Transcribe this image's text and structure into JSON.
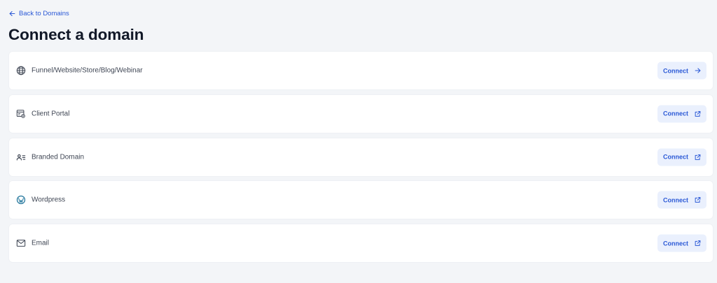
{
  "back_link": {
    "label": "Back to Domains",
    "icon": "arrow-left-icon"
  },
  "page_title": "Connect a domain",
  "colors": {
    "background": "#f3f5f8",
    "card": "#ffffff",
    "accent": "#2b59d6",
    "button_bg": "#eaf0fd",
    "title": "#111827",
    "label": "#3f4654"
  },
  "options": [
    {
      "label": "Funnel/Website/Store/Blog/Webinar",
      "icon": "globe-icon",
      "button_label": "Connect",
      "button_icon": "arrow-right-icon"
    },
    {
      "label": "Client Portal",
      "icon": "client-portal-icon",
      "button_label": "Connect",
      "button_icon": "external-link-icon"
    },
    {
      "label": "Branded Domain",
      "icon": "user-list-icon",
      "button_label": "Connect",
      "button_icon": "external-link-icon"
    },
    {
      "label": "Wordpress",
      "icon": "wordpress-icon",
      "button_label": "Connect",
      "button_icon": "external-link-icon"
    },
    {
      "label": "Email",
      "icon": "mail-icon",
      "button_label": "Connect",
      "button_icon": "external-link-icon"
    }
  ]
}
